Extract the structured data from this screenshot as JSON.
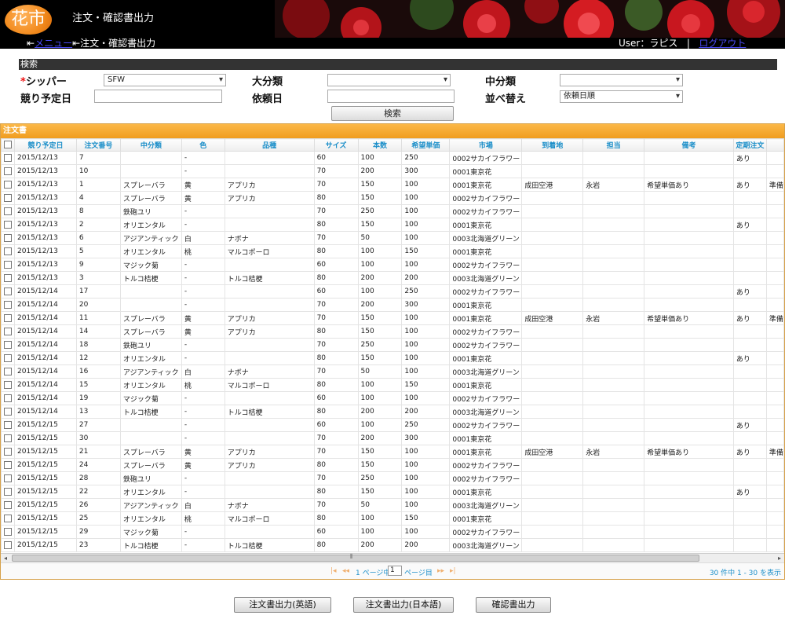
{
  "header": {
    "logo_text": "花市",
    "title": "注文・確認書出力",
    "breadcrumb": {
      "menu_link": "メニュー",
      "current": "注文・確認書出力"
    },
    "user_label": "User：ラピス",
    "separator": "|",
    "logout": "ログアウト"
  },
  "search": {
    "section_title": "検索",
    "shipper_label": "シッパー",
    "shipper_value": "SFW",
    "auction_date_label": "競り予定日",
    "auction_date_value": "",
    "major_category_label": "大分類",
    "major_category_value": "",
    "request_date_label": "依頼日",
    "request_date_value": "",
    "mid_category_label": "中分類",
    "mid_category_value": "",
    "sort_label": "並べ替え",
    "sort_value": "依頼日順",
    "search_button": "検索"
  },
  "grid": {
    "title": "注文書",
    "columns": [
      "競り予定日",
      "注文番号",
      "中分類",
      "色",
      "品種",
      "サイズ",
      "本数",
      "希望単価",
      "市場",
      "到着地",
      "担当",
      "備考",
      "定期注文"
    ],
    "rows": [
      [
        "2015/12/13",
        "7",
        "",
        "-",
        "",
        "60",
        "100",
        "250",
        "0002サカイフラワー",
        "",
        "",
        "",
        "あり",
        ""
      ],
      [
        "2015/12/13",
        "10",
        "",
        "-",
        "",
        "70",
        "200",
        "300",
        "0001東京花",
        "",
        "",
        "",
        "",
        ""
      ],
      [
        "2015/12/13",
        "1",
        "スプレーバラ",
        "黄",
        "アプリカ",
        "70",
        "150",
        "100",
        "0001東京花",
        "成田空港",
        "永岩",
        "希望単価あり",
        "あり",
        "準備"
      ],
      [
        "2015/12/13",
        "4",
        "スプレーバラ",
        "黄",
        "アプリカ",
        "80",
        "150",
        "100",
        "0002サカイフラワー",
        "",
        "",
        "",
        "",
        ""
      ],
      [
        "2015/12/13",
        "8",
        "鉄砲ユリ",
        "-",
        "",
        "70",
        "250",
        "100",
        "0002サカイフラワー",
        "",
        "",
        "",
        "",
        ""
      ],
      [
        "2015/12/13",
        "2",
        "オリエンタル",
        "-",
        "",
        "80",
        "150",
        "100",
        "0001東京花",
        "",
        "",
        "",
        "あり",
        ""
      ],
      [
        "2015/12/13",
        "6",
        "アジアンティック",
        "白",
        "ナボナ",
        "70",
        "50",
        "100",
        "0003北海道グリーン",
        "",
        "",
        "",
        "",
        ""
      ],
      [
        "2015/12/13",
        "5",
        "オリエンタル",
        "桃",
        "マルコポーロ",
        "80",
        "100",
        "150",
        "0001東京花",
        "",
        "",
        "",
        "",
        ""
      ],
      [
        "2015/12/13",
        "9",
        "マジック菊",
        "-",
        "",
        "60",
        "100",
        "100",
        "0002サカイフラワー",
        "",
        "",
        "",
        "",
        ""
      ],
      [
        "2015/12/13",
        "3",
        "トルコ桔梗",
        "-",
        "トルコ桔梗",
        "80",
        "200",
        "200",
        "0003北海道グリーン",
        "",
        "",
        "",
        "",
        ""
      ],
      [
        "2015/12/14",
        "17",
        "",
        "-",
        "",
        "60",
        "100",
        "250",
        "0002サカイフラワー",
        "",
        "",
        "",
        "あり",
        ""
      ],
      [
        "2015/12/14",
        "20",
        "",
        "-",
        "",
        "70",
        "200",
        "300",
        "0001東京花",
        "",
        "",
        "",
        "",
        ""
      ],
      [
        "2015/12/14",
        "11",
        "スプレーバラ",
        "黄",
        "アプリカ",
        "70",
        "150",
        "100",
        "0001東京花",
        "成田空港",
        "永岩",
        "希望単価あり",
        "あり",
        "準備"
      ],
      [
        "2015/12/14",
        "14",
        "スプレーバラ",
        "黄",
        "アプリカ",
        "80",
        "150",
        "100",
        "0002サカイフラワー",
        "",
        "",
        "",
        "",
        ""
      ],
      [
        "2015/12/14",
        "18",
        "鉄砲ユリ",
        "-",
        "",
        "70",
        "250",
        "100",
        "0002サカイフラワー",
        "",
        "",
        "",
        "",
        ""
      ],
      [
        "2015/12/14",
        "12",
        "オリエンタル",
        "-",
        "",
        "80",
        "150",
        "100",
        "0001東京花",
        "",
        "",
        "",
        "あり",
        ""
      ],
      [
        "2015/12/14",
        "16",
        "アジアンティック",
        "白",
        "ナボナ",
        "70",
        "50",
        "100",
        "0003北海道グリーン",
        "",
        "",
        "",
        "",
        ""
      ],
      [
        "2015/12/14",
        "15",
        "オリエンタル",
        "桃",
        "マルコポーロ",
        "80",
        "100",
        "150",
        "0001東京花",
        "",
        "",
        "",
        "",
        ""
      ],
      [
        "2015/12/14",
        "19",
        "マジック菊",
        "-",
        "",
        "60",
        "100",
        "100",
        "0002サカイフラワー",
        "",
        "",
        "",
        "",
        ""
      ],
      [
        "2015/12/14",
        "13",
        "トルコ桔梗",
        "-",
        "トルコ桔梗",
        "80",
        "200",
        "200",
        "0003北海道グリーン",
        "",
        "",
        "",
        "",
        ""
      ],
      [
        "2015/12/15",
        "27",
        "",
        "-",
        "",
        "60",
        "100",
        "250",
        "0002サカイフラワー",
        "",
        "",
        "",
        "あり",
        ""
      ],
      [
        "2015/12/15",
        "30",
        "",
        "-",
        "",
        "70",
        "200",
        "300",
        "0001東京花",
        "",
        "",
        "",
        "",
        ""
      ],
      [
        "2015/12/15",
        "21",
        "スプレーバラ",
        "黄",
        "アプリカ",
        "70",
        "150",
        "100",
        "0001東京花",
        "成田空港",
        "永岩",
        "希望単価あり",
        "あり",
        "準備"
      ],
      [
        "2015/12/15",
        "24",
        "スプレーバラ",
        "黄",
        "アプリカ",
        "80",
        "150",
        "100",
        "0002サカイフラワー",
        "",
        "",
        "",
        "",
        ""
      ],
      [
        "2015/12/15",
        "28",
        "鉄砲ユリ",
        "-",
        "",
        "70",
        "250",
        "100",
        "0002サカイフラワー",
        "",
        "",
        "",
        "",
        ""
      ],
      [
        "2015/12/15",
        "22",
        "オリエンタル",
        "-",
        "",
        "80",
        "150",
        "100",
        "0001東京花",
        "",
        "",
        "",
        "あり",
        ""
      ],
      [
        "2015/12/15",
        "26",
        "アジアンティック",
        "白",
        "ナボナ",
        "70",
        "50",
        "100",
        "0003北海道グリーン",
        "",
        "",
        "",
        "",
        ""
      ],
      [
        "2015/12/15",
        "25",
        "オリエンタル",
        "桃",
        "マルコポーロ",
        "80",
        "100",
        "150",
        "0001東京花",
        "",
        "",
        "",
        "",
        ""
      ],
      [
        "2015/12/15",
        "29",
        "マジック菊",
        "-",
        "",
        "60",
        "100",
        "100",
        "0002サカイフラワー",
        "",
        "",
        "",
        "",
        ""
      ],
      [
        "2015/12/15",
        "23",
        "トルコ桔梗",
        "-",
        "トルコ桔梗",
        "80",
        "200",
        "200",
        "0003北海道グリーン",
        "",
        "",
        "",
        "",
        ""
      ]
    ],
    "pager": {
      "page_prefix": "1 ページ中",
      "page_value": "1",
      "page_suffix": "ページ目",
      "record_count": "30 件中 1 - 30 を表示"
    }
  },
  "actions": {
    "order_en": "注文書出力(英語)",
    "order_ja": "注文書出力(日本語)",
    "confirm": "確認書出力"
  },
  "colors": {
    "header_bg": "#000000",
    "grid_title_bg": "#f5a623",
    "column_header_text": "#1c8fc9",
    "link": "#4a4af5",
    "required_mark": "#ee1111"
  }
}
